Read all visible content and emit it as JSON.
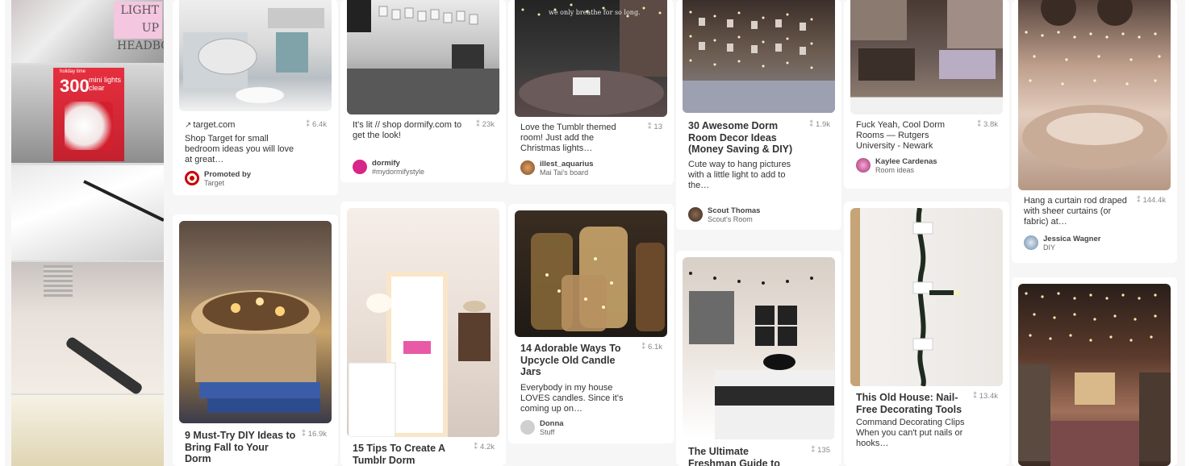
{
  "left_panel": {
    "headboard_text": "LIGHT UP HEADBOARD",
    "box_brand": "holiday time",
    "box_count": "300",
    "box_desc": "mini lights clear"
  },
  "pins": [
    {
      "id": "pin1",
      "source": "target.com",
      "saves": "6.4k",
      "description": "Shop Target for small bedroom ideas you will love at great…",
      "attrib_name": "Promoted by",
      "attrib_board": "Target"
    },
    {
      "id": "pin2",
      "saves": "23k",
      "description": "It's lit // shop dormify.com to get the look!",
      "attrib_name": "dormify",
      "attrib_board": "#mydormifystyle"
    },
    {
      "id": "pin3",
      "saves": "13",
      "description": "Love the Tumblr themed room! Just add the Christmas lights…",
      "attrib_name": "illest_aquarius",
      "attrib_board": "Mai Tai's board",
      "image_text": "we only breathe for so long."
    },
    {
      "id": "pin4",
      "saves": "1.9k",
      "title": "30 Awesome Dorm Room Decor Ideas (Money Saving & DIY)",
      "description": "Cute way to hang pictures with a little light to add to the…",
      "attrib_name": "Scout Thomas",
      "attrib_board": "Scout's Room"
    },
    {
      "id": "pin5",
      "saves": "3.8k",
      "description": "Fuck Yeah, Cool Dorm Rooms — Rutgers University - Newark",
      "attrib_name": "Kaylee Cardenas",
      "attrib_board": "Room ideas"
    },
    {
      "id": "pin6",
      "saves": "144.4k",
      "description": "Hang a curtain rod draped with sheer curtains (or fabric) at…",
      "attrib_name": "Jessica Wagner",
      "attrib_board": "DIY"
    },
    {
      "id": "pin7",
      "saves": "16.9k",
      "title": "9 Must-Try DIY Ideas to Bring Fall to Your Dorm"
    },
    {
      "id": "pin8",
      "saves": "4.2k",
      "title": "15 Tips To Create A Tumblr Dorm"
    },
    {
      "id": "pin9",
      "saves": "6.1k",
      "title": "14 Adorable Ways To Upcycle Old Candle Jars",
      "description": "Everybody in my house LOVES candles. Since it's coming up on…",
      "attrib_name": "Donna",
      "attrib_board": "Stuff"
    },
    {
      "id": "pin10",
      "saves": "135",
      "title": "The Ultimate Freshman Guide to"
    },
    {
      "id": "pin11",
      "saves": "13.4k",
      "title": "This Old House: Nail-Free Decorating Tools",
      "description": "Command Decorating Clips When you can't put nails or hooks…"
    },
    {
      "id": "pin12"
    }
  ],
  "colors": {
    "background": "#f6f6f6",
    "card": "#ffffff",
    "text": "#333333",
    "muted": "#888888",
    "target_red": "#cc0000",
    "dormify_pink": "#d6268a"
  }
}
